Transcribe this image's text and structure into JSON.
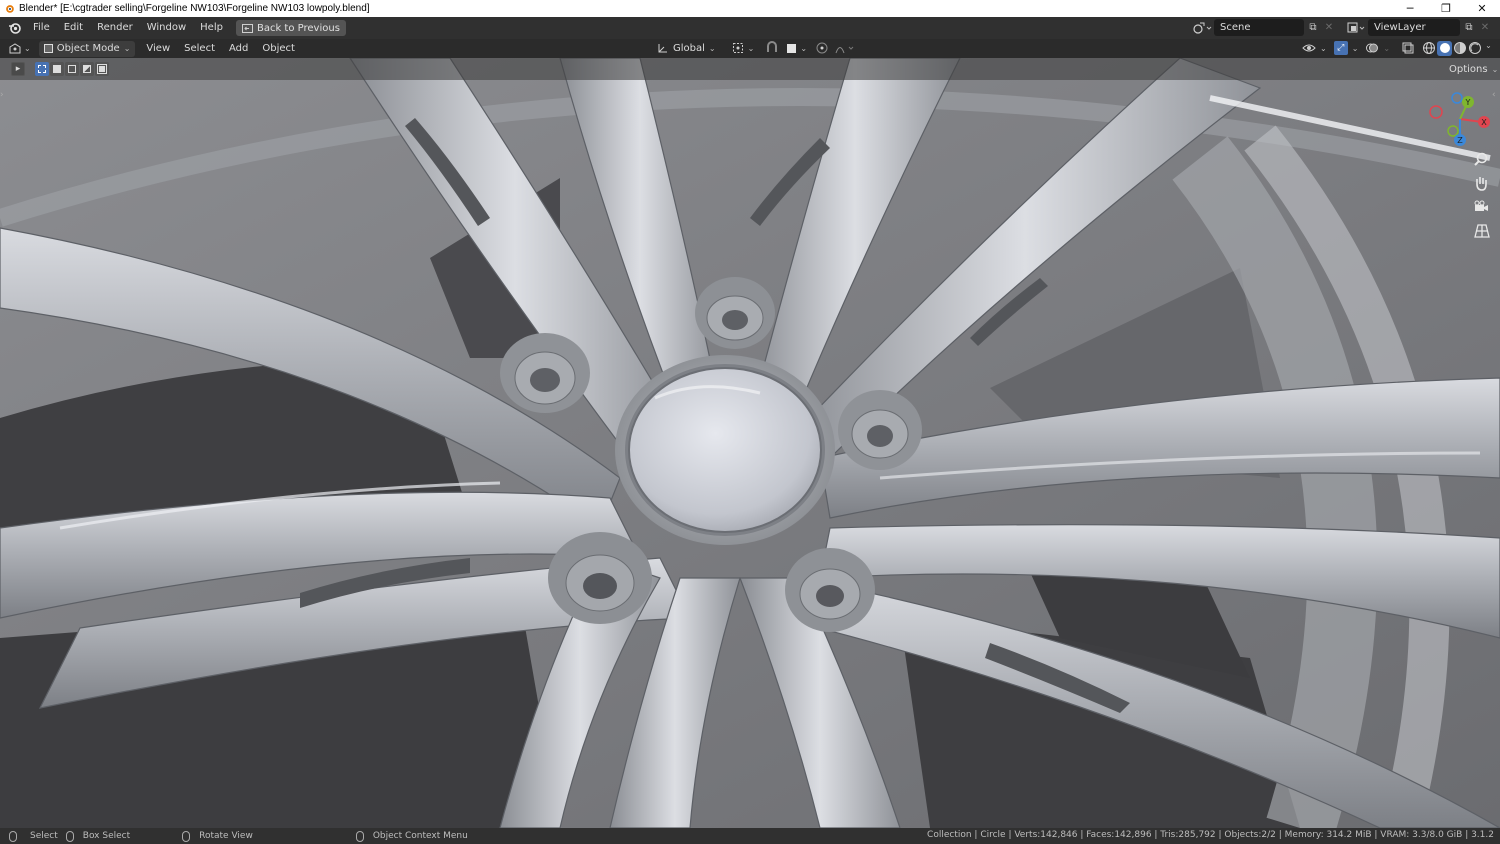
{
  "window": {
    "title": "Blender* [E:\\cgtrader selling\\Forgeline NW103\\Forgeline NW103 lowpoly.blend]",
    "minimize": "─",
    "restore": "❐",
    "close": "✕"
  },
  "topbar": {
    "menus": [
      "File",
      "Edit",
      "Render",
      "Window",
      "Help"
    ],
    "back_button": "Back to Previous",
    "scene": "Scene",
    "view_layer": "ViewLayer"
  },
  "viewport_header": {
    "mode": "Object Mode",
    "menus": [
      "View",
      "Select",
      "Add",
      "Object"
    ],
    "transform_orientation": "Global",
    "options": "Options"
  },
  "gizmo": {
    "axes": {
      "x": "X",
      "y": "Y",
      "z": "Z"
    },
    "colors": {
      "x": "#e0454f",
      "y": "#7fb62f",
      "z": "#3b88d9"
    }
  },
  "nav_icons": [
    "zoom-icon",
    "pan-hand-icon",
    "camera-icon",
    "ortho-grid-icon"
  ],
  "statusbar": {
    "select": "Select",
    "box_select": "Box Select",
    "rotate_view": "Rotate View",
    "context_menu": "Object Context Menu",
    "stats": "Collection | Circle | Verts:142,846 | Faces:142,896 | Tris:285,792 | Objects:2/2 | Memory: 314.2 MiB | VRAM: 3.3/8.0 GiB | 3.1.2"
  }
}
